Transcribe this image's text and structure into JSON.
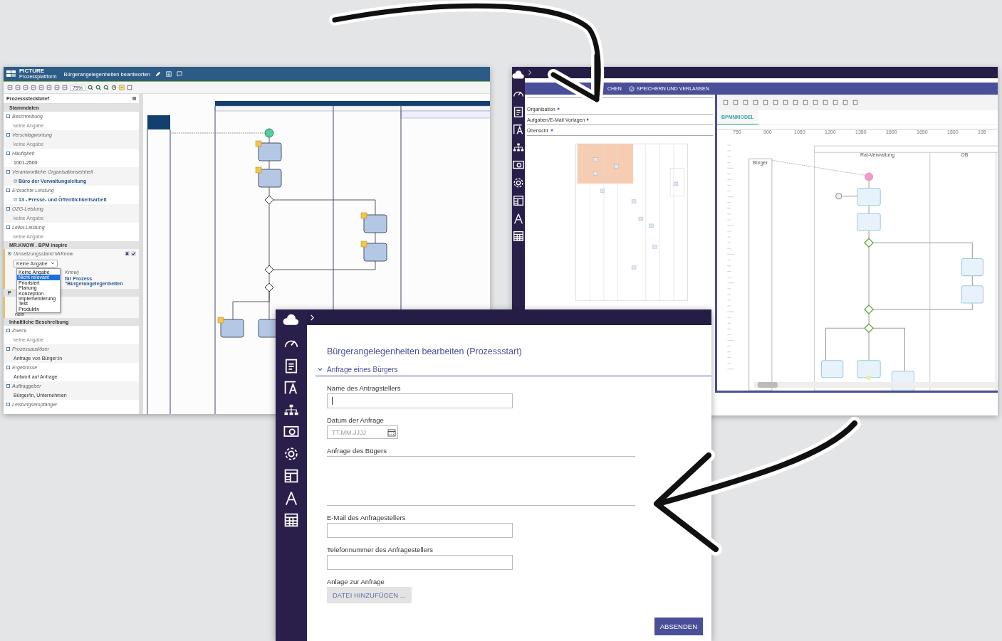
{
  "left_window": {
    "logo": {
      "brand": "PICTURE",
      "subtitle": "Prozessplattform"
    },
    "title": "Bürgerangelegenheiten beantworten",
    "zoom": "75%",
    "panel": {
      "title": "Prozesssteckbrief",
      "stammdaten": {
        "header": "Stammdaten",
        "fields": [
          {
            "label": "Beschreibung",
            "value": "keine Angabe",
            "kind": "empty"
          },
          {
            "label": "Verschlagwortung",
            "value": "keine Angabe",
            "kind": "empty"
          },
          {
            "label": "Häufigkeit",
            "value": "1001-2500",
            "kind": "text"
          },
          {
            "label": "Verantwortliche Organisationseinheit",
            "value": "Büro der Verwaltungsleitung",
            "kind": "link"
          },
          {
            "label": "Erbrachte Leistung",
            "value": "13 - Presse- und Öffentlichkeitsarbeit",
            "kind": "link"
          },
          {
            "label": "OZG-Leistung",
            "value": "keine Angabe",
            "kind": "empty"
          },
          {
            "label": "Leika-Leistung",
            "value": "keine Angabe",
            "kind": "empty"
          }
        ]
      },
      "mrknow": {
        "header": "MR.KNOW . BPM inspire",
        "label": "Umsetzungsstand MrKnow",
        "value": "Keine Angabe",
        "options": [
          {
            "label": "Keine Angabe",
            "highlighted": false
          },
          {
            "label": "Nicht relevant",
            "highlighted": true
          },
          {
            "label": "Priorisiert",
            "highlighted": false
          },
          {
            "label": "Planung",
            "highlighted": false
          },
          {
            "label": "Konzeption",
            "highlighted": false
          },
          {
            "label": "Implementierung",
            "highlighted": false
          },
          {
            "label": "Test",
            "highlighted": false
          },
          {
            "label": "Produktiv",
            "highlighted": false
          }
        ],
        "covered_label": "Know)",
        "covered_link": "für Prozess \"Bürgerangelegenheiten",
        "covered_header": "P",
        "covered_value": "nein"
      },
      "inhalt": {
        "header": "Inhaltliche Beschreibung",
        "fields": [
          {
            "label": "Zweck",
            "value": "keine Angabe",
            "kind": "empty"
          },
          {
            "label": "Prozessauslöser",
            "value": "Anfrage von Bürger:in",
            "kind": "text"
          },
          {
            "label": "Ergebnisse",
            "value": "Antwort auf Anfrage",
            "kind": "text"
          },
          {
            "label": "Auftraggeber",
            "value": "Bürger/in, Unternehmen",
            "kind": "text"
          },
          {
            "label": "Leistungsempfänger"
          }
        ]
      }
    }
  },
  "right_window": {
    "cut_action": "CHEN",
    "save_action": "SPEICHERN UND VERLASSEN",
    "menu": [
      {
        "label": "Organisation",
        "expanded": false
      },
      {
        "label": "Aufgaben/E-Mail Vorlagen",
        "expanded": false
      },
      {
        "label": "Übersicht",
        "expanded": true
      }
    ],
    "tab": "BPMNMODEL",
    "ruler_marks": [
      "750",
      "900",
      "1050",
      "1200",
      "1350",
      "1500",
      "1650",
      "1800",
      "195"
    ],
    "lanes": [
      "Rat-Verwaltung",
      "OB"
    ],
    "participant": "Bürger"
  },
  "form_window": {
    "title": "Bürgerangelegenheiten bearbeiten (Prozessstart)",
    "section": {
      "label": "Anfrage eines Bürgers",
      "expanded": true
    },
    "fields": [
      {
        "kind": "text",
        "label": "Name des Antragstellers",
        "focused": true
      },
      {
        "kind": "date",
        "label": "Datum der Anfrage",
        "placeholder": "TT.MM.JJJJ"
      },
      {
        "kind": "textarea",
        "label": "Anfrage des Bügers"
      },
      {
        "kind": "text",
        "label": "E-Mail des Anfragestellers",
        "focused": false
      },
      {
        "kind": "text",
        "label": "Telefonnummer des Anfragestellers",
        "focused": false
      },
      {
        "kind": "file",
        "label": "Anlage zur Anfrage",
        "button": "DATEI HINZUFÜGEN ..."
      }
    ],
    "submit": "ABSENDEN"
  }
}
